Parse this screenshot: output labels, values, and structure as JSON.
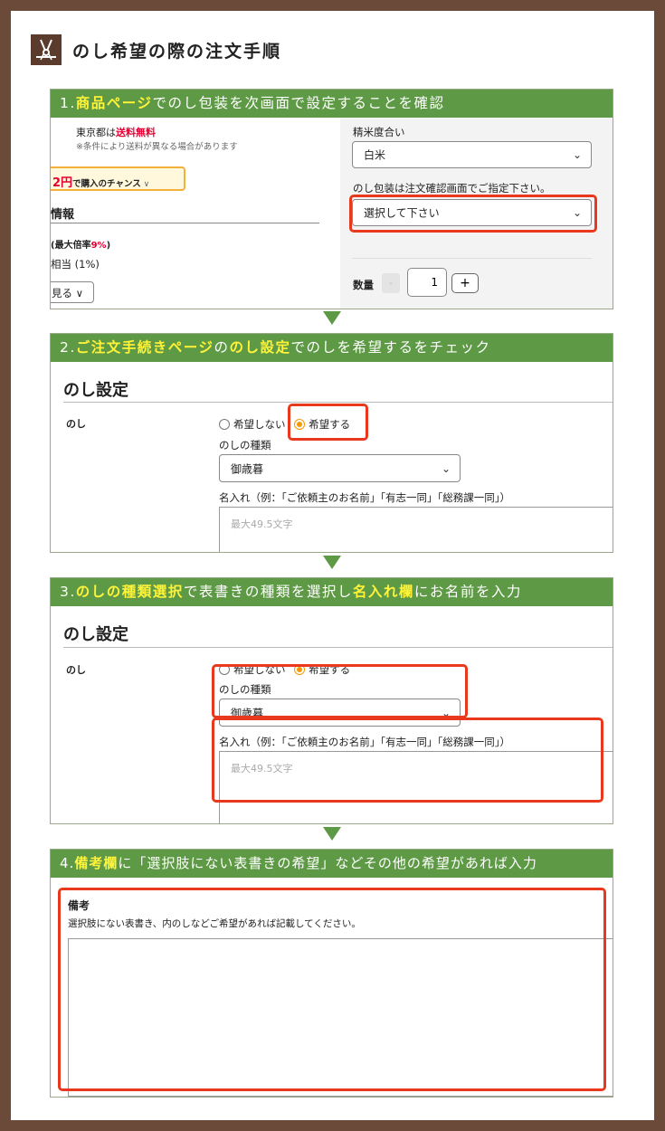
{
  "header": {
    "title": "のし希望の際の注文手順",
    "icon": "noshi-ribbon-icon"
  },
  "colors": {
    "accent": "#5e9a45",
    "highlight": "#fff33a",
    "frame": "#e8391e",
    "border": "#6b4a3a"
  },
  "step1": {
    "bar": {
      "num": "1.",
      "hl1": "商品ページ",
      "rest1": "でのし包装を次画面で設定することを確認"
    },
    "shipping_pre": "東京都は",
    "shipping_hl": "送料無料",
    "shipping_note": "※条件により送料が異なる場合があります",
    "chance_amount": "2円",
    "chance_text": "で購入のチャンス",
    "info_heading": "情報",
    "rate_pre": "(最大倍率",
    "rate_hl": "9%",
    "rate_post": ")",
    "equiv": "相当 (1%)",
    "see_more": "見る",
    "polish_label": "精米度合い",
    "polish_value": "白米",
    "noshi_note": "のし包装は注文確認画面でご指定下さい。",
    "noshi_select": "選択して下さい",
    "qty_label": "数量",
    "qty_minus": "-",
    "qty_value": "1",
    "qty_plus": "+"
  },
  "step2": {
    "bar": {
      "num": "2.",
      "hl1": "ご注文手続きページ",
      "mid": "の",
      "hl2": "のし設定",
      "rest": "でのしを希望するをチェック"
    },
    "heading": "のし設定",
    "row_label": "のし",
    "radio_no": "希望しない",
    "radio_yes": "希望する",
    "type_label": "のしの種類",
    "type_value": "御歳暮",
    "name_label": "名入れ（例：「ご依頼主のお名前」「有志一同」「総務課一同」）",
    "name_placeholder": "最大49.5文字"
  },
  "step3": {
    "bar": {
      "num": "3.",
      "hl1": "のしの種類選択",
      "mid": "で表書きの種類を選択し",
      "hl2": "名入れ欄",
      "rest": "にお名前を入力"
    },
    "heading": "のし設定",
    "row_label": "のし",
    "radio_no": "希望しない",
    "radio_yes": "希望する",
    "type_label": "のしの種類",
    "type_value": "御歳暮",
    "name_label": "名入れ（例：「ご依頼主のお名前」「有志一同」「総務課一同」）",
    "name_placeholder": "最大49.5文字"
  },
  "step4": {
    "bar": {
      "num": "4.",
      "hl1": "備考欄",
      "rest": "に「選択肢にない表書きの希望」などその他の希望があれば入力"
    },
    "heading": "備考",
    "desc": "選択肢にない表書き、内のしなどご希望があれば記載してください。"
  }
}
